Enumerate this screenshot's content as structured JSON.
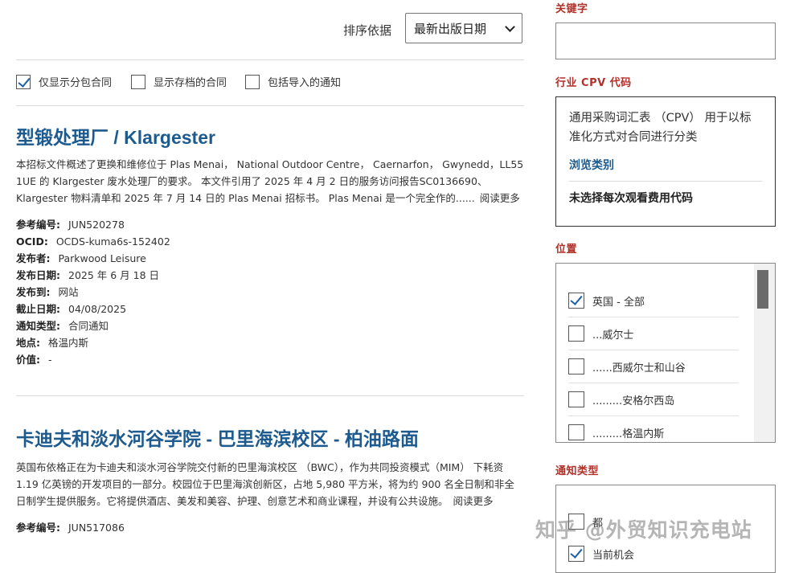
{
  "sort": {
    "label": "排序依据",
    "selected": "最新出版日期"
  },
  "filters": [
    {
      "label": "仅显示分包合同",
      "checked": true
    },
    {
      "label": "显示存档的合同",
      "checked": false
    },
    {
      "label": "包括导入的通知",
      "checked": false
    }
  ],
  "results": [
    {
      "title": "型锻处理厂 / Klargester",
      "description": "本招标文件概述了更换和维修位于 Plas Menai， National Outdoor Centre， Caernarfon， Gwynedd，LL55 1UE 的 Klargester 废水处理厂的要求。 本文件引用了 2025 年 4 月 2 日的服务访问报告SC0136690、Klargester 物料清单和 2025 年 7 月 14 日的 Plas Menai 招标书。 Plas Menai 是一个完全作的......",
      "read_more": "阅读更多",
      "meta": [
        {
          "label": "参考编号:",
          "value": "JUN520278"
        },
        {
          "label": "OCID:",
          "value": "OCDS-kuma6s-152402"
        },
        {
          "label": "发布者:",
          "value": "Parkwood Leisure"
        },
        {
          "label": "发布日期:",
          "value": "2025 年 6 月 18 日"
        },
        {
          "label": "发布到:",
          "value": "网站"
        },
        {
          "label": "截止日期:",
          "value": "04/08/2025"
        },
        {
          "label": "通知类型:",
          "value": "合同通知"
        },
        {
          "label": "地点:",
          "value": "格温内斯"
        },
        {
          "label": "价值:",
          "value": "-"
        }
      ]
    },
    {
      "title": "卡迪夫和淡水河谷学院 - 巴里海滨校区 - 柏油路面",
      "description": "英国布依格正在为卡迪夫和淡水河谷学院交付新的巴里海滨校区 （BWC），作为共同投资模式（MIM） 下耗资 1.19 亿英镑的开发项目的一部分。校园位于巴里海滨创新区，占地 5,980 平方米，将为约 900 名全日制和非全日制学生提供服务。它将提供酒店、美发和美容、护理、创意艺术和商业课程，并设有公共设施。",
      "read_more": "阅读更多",
      "meta": [
        {
          "label": "参考编号:",
          "value": "JUN517086"
        }
      ]
    }
  ],
  "sidebar": {
    "keyword_title": "关键字",
    "cpv_title": "行业 CPV 代码",
    "cpv_text": "通用采购词汇表 （CPV） 用于以标准化方式对合同进行分类",
    "cpv_link": "浏览类别",
    "cpv_none": "未选择每次观看费用代码",
    "location_title": "位置",
    "locations": [
      {
        "label": "英国 - 全部",
        "checked": true
      },
      {
        "label": "...威尔士",
        "checked": false
      },
      {
        "label": "......西威尔士和山谷",
        "checked": false
      },
      {
        "label": ".........安格尔西岛",
        "checked": false
      },
      {
        "label": ".........格温内斯",
        "checked": false
      }
    ],
    "notice_title": "通知类型",
    "notices": [
      {
        "label": "都",
        "checked": false
      },
      {
        "label": "当前机会",
        "checked": true
      }
    ]
  },
  "watermark": "知乎 @外贸知识充电站",
  "colors": {
    "title_blue": "#1d5a8e",
    "section_red": "#b0302a",
    "check_blue": "#1a5fa8"
  }
}
